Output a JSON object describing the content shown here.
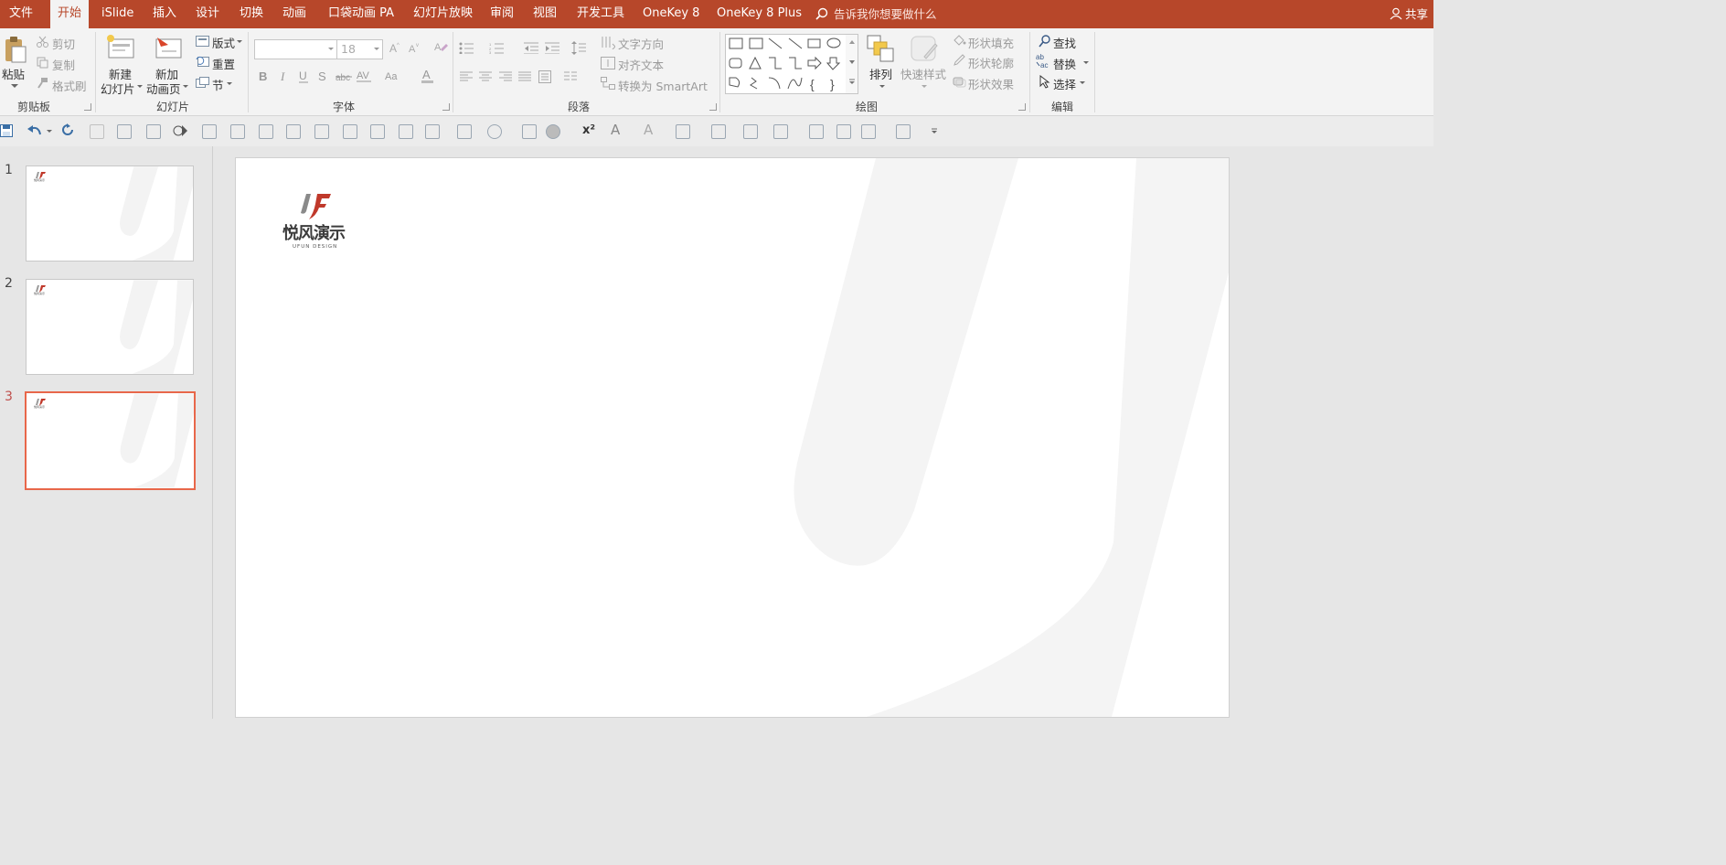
{
  "menu": {
    "tabs": [
      "文件",
      "开始",
      "iSlide",
      "插入",
      "设计",
      "切换",
      "动画",
      "口袋动画 PA",
      "幻灯片放映",
      "审阅",
      "视图",
      "开发工具",
      "OneKey 8",
      "OneKey 8 Plus"
    ],
    "active_tab": "开始",
    "tell_me": "告诉我你想要做什么",
    "share": "共享"
  },
  "ribbon": {
    "clipboard": {
      "paste": "粘贴",
      "cut": "剪切",
      "copy": "复制",
      "format_painter": "格式刷",
      "label": "剪贴板"
    },
    "slides": {
      "new_slide_1": "新建",
      "new_slide_2": "幻灯片",
      "new_anim_1": "新加",
      "new_anim_2": "动画页",
      "layout": "版式",
      "reset": "重置",
      "section": "节",
      "label": "幻灯片"
    },
    "font": {
      "size": "18",
      "label": "字体"
    },
    "paragraph": {
      "text_direction": "文字方向",
      "align_text": "对齐文本",
      "smartart": "转换为 SmartArt",
      "label": "段落"
    },
    "drawing": {
      "arrange": "排列",
      "quick_styles": "快速样式",
      "shape_fill": "形状填充",
      "shape_outline": "形状轮廓",
      "shape_effects": "形状效果",
      "label": "绘图"
    },
    "editing": {
      "find": "查找",
      "replace": "替换",
      "select": "选择",
      "label": "编辑"
    }
  },
  "slides": [
    {
      "number": "1",
      "selected": false
    },
    {
      "number": "2",
      "selected": false
    },
    {
      "number": "3",
      "selected": true
    }
  ],
  "logo": {
    "name": "悦风演示",
    "tagline": "UFUN DESIGN"
  },
  "colors": {
    "accent": "#b7472a",
    "selection": "#e8674a",
    "logo_red": "#c0392b"
  }
}
